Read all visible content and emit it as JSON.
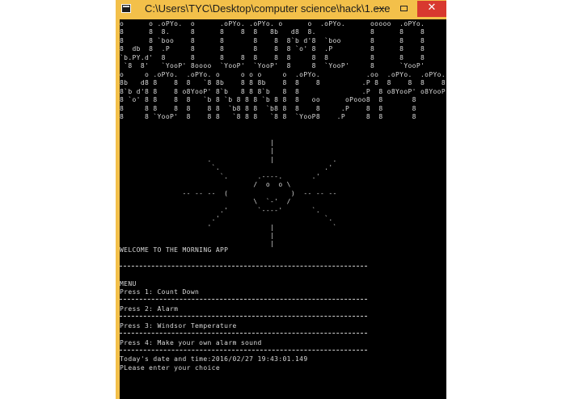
{
  "window": {
    "title": "C:\\Users\\TYC\\Desktop\\computer science\\hack\\1.exe",
    "minimize_label": "—",
    "close_label": "✕"
  },
  "console": {
    "banner_art": "o      o .oPYo.  o      .oPYo. .oPYo. o      o  .oPYo.      ooooo  .oPYo.\n8      8  8.     8      8    8  8   8b   d8  8.             8      8    8\n8      8 `boo    8      8       8    8  8`b d'8  `boo       8      8    8\n8  db  8  .P     8      8       8    8  8 `o' 8  .P         8      8    8\n`b.PY.d'  8      8      8    8  8    8  8     8  8          8      8    8\n `8  8'   `YooP' 8oooo  `YooP'  `YooP'  8     8  `YooP'     8      `YooP'\no     o .oPYo.  .oPYo. o     o o o     o  .oPYo.           .oo  .oPYo.  .oPYo.\n8b   d8 8    8  8   `8 8b    8 8 8b    8  8    8          .P 8  8    8  8    8\n8`b d'8 8    8 o8YooP' 8`b   8 8 8`b   8  8               .P  8 o8YooP' o8YooP'\n8 `o' 8 8    8  8   `b 8 `b 8 8 8 `b 8 8  8   oo      oPooo8  8       8\n8     8 8    8  8    8 8  `b8 8 8  `b8 8  8    8     .P    8  8       8\n8     8 `YooP'  8    8 8   `8 8 8   `8 8  `YooP8    .P     8  8       8",
    "sun_art": "                                    |\n                                    |\n                     .              |              .\n                      `.                         .'\n                        `.       .----.       .'\n                                /  o  o \\\n               -- -- --  (               )  -- -- --\n                                \\  `-'  /\n                        .'       `----'       `.\n                      .'                         `.\n                     '              |              `\n                                    |\n                                    |",
    "welcome": "WELCOME TO THE MORNING APP",
    "menu_title": "MENU",
    "options": [
      "Press 1: Count Down",
      "Press 2: Alarm",
      "Press 3: Windsor Temperature",
      "Press 4: Make your own alarm sound"
    ],
    "datetime": "Today's date and time:2016/02/27 19:43:01.149",
    "prompt": "PLease enter your choice"
  }
}
